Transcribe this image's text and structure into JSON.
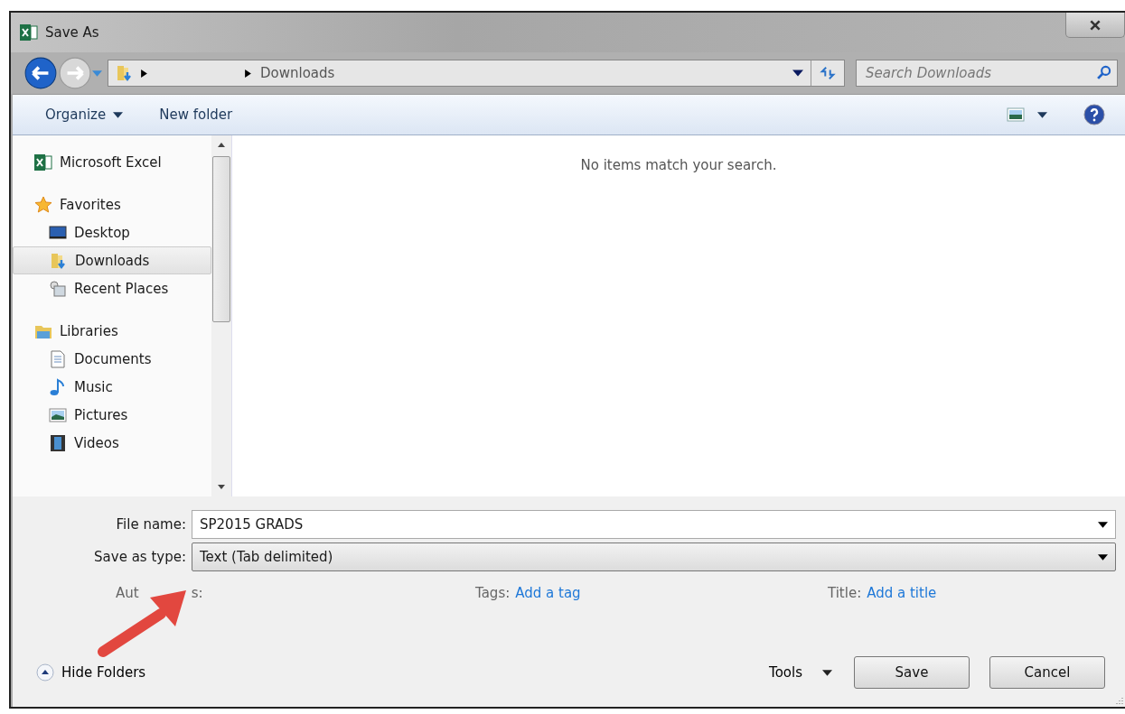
{
  "window": {
    "title": "Save As"
  },
  "address": {
    "segments": [
      "Downloads"
    ],
    "search_placeholder": "Search Downloads"
  },
  "toolbar": [
    {
      "label": "Organize",
      "kind": "menu"
    },
    {
      "label": "New folder",
      "kind": "plain"
    }
  ],
  "sidebar": [
    {
      "label": "Microsoft Excel",
      "kind": "excel",
      "selected": false
    },
    {
      "label": "Favorites",
      "kind": "star",
      "selected": false,
      "children": [
        {
          "label": "Desktop",
          "kind": "desktop",
          "selected": false
        },
        {
          "label": "Downloads",
          "kind": "downloads",
          "selected": true
        },
        {
          "label": "Recent Places",
          "kind": "recent",
          "selected": false
        }
      ]
    },
    {
      "label": "Libraries",
      "kind": "libraries",
      "selected": false,
      "children": [
        {
          "label": "Documents",
          "kind": "documents",
          "selected": false
        },
        {
          "label": "Music",
          "kind": "music",
          "selected": false
        },
        {
          "label": "Pictures",
          "kind": "pictures",
          "selected": false
        },
        {
          "label": "Videos",
          "kind": "videos",
          "selected": false
        }
      ]
    }
  ],
  "content": {
    "empty_message": "No items match your search."
  },
  "fields": [
    {
      "label": "File name:",
      "value": "SP2015 GRADS",
      "kind": "input"
    },
    {
      "label": "Save as type:",
      "value": "Text (Tab delimited)",
      "kind": "select"
    }
  ],
  "metadata": [
    {
      "label": "Aut",
      "label_tail": "s:"
    },
    {
      "label": "Tags:",
      "link": "Add a tag"
    },
    {
      "label": "Title:",
      "link": "Add a title"
    }
  ],
  "footer": {
    "hide_folders": "Hide Folders",
    "tools": "Tools",
    "buttons": [
      "Save",
      "Cancel"
    ]
  }
}
